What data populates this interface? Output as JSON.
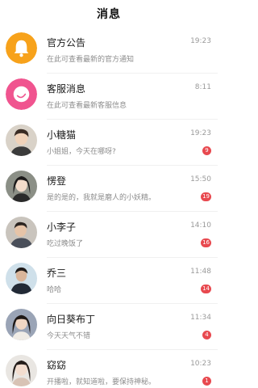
{
  "header": {
    "title": "消息"
  },
  "rows": [
    {
      "name": "官方公告",
      "time": "19:23",
      "preview": "在此可查看最新的官方通知",
      "icon": "bell-icon",
      "color": "#f7a21b"
    },
    {
      "name": "客服消息",
      "time": "8:11",
      "preview": "在此可查看最新客服信息",
      "icon": "chat-bubble-icon",
      "color": "#f0548f"
    },
    {
      "name": "小糖猫",
      "time": "19:23",
      "preview": "小姐姐，今天在哪呀?",
      "badge": "9"
    },
    {
      "name": "愣登",
      "time": "15:50",
      "preview": "是的是的，我就是磨人的小妖精。",
      "badge": "19"
    },
    {
      "name": "小李子",
      "time": "14:10",
      "preview": "吃过晚饭了",
      "badge": "16"
    },
    {
      "name": "乔三",
      "time": "11:48",
      "preview": "哈哈",
      "badge": "14"
    },
    {
      "name": "向日葵布丁",
      "time": "11:34",
      "preview": "今天天气不错",
      "badge": "4"
    },
    {
      "name": "窈窈",
      "time": "10:23",
      "preview": "开播啦，就知道啦，要保持神秘。",
      "badge": "1"
    }
  ],
  "colors": {
    "badge": "#e8494f"
  }
}
